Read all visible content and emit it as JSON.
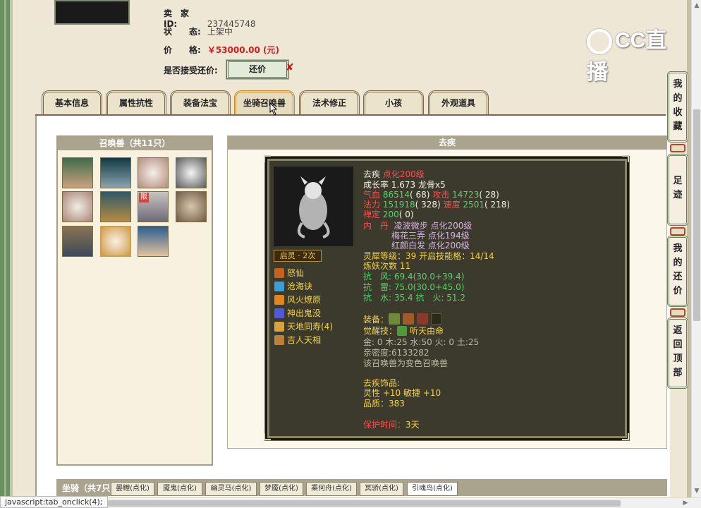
{
  "seller": {
    "id_label": "卖　家　ID:",
    "id_value": "237445748",
    "status_label": "状　　态:",
    "status_value": "上架中",
    "price_label": "价　　格:",
    "price_value": "￥53000.00 (元)",
    "counter_label": "是否接受还价:",
    "counter_button": "还价",
    "counter_no": "✘"
  },
  "logo": {
    "text": "CC直播"
  },
  "tabs": [
    "基本信息",
    "属性抗性",
    "装备法宝",
    "坐骑召唤兽",
    "法术修正",
    "小孩",
    "外观道具"
  ],
  "active_tab": "坐骑召唤兽",
  "pet_list": {
    "title": "召唤兽（共11只）",
    "count": 11,
    "limited_badge": "限"
  },
  "detail": {
    "title": "去疾",
    "name": "去疾",
    "name_note": "点化200级",
    "growth": "成长率 1.673 龙骨x5",
    "qixue_label": "气血",
    "qixue_value": "86514",
    "qixue_paren": "( 68)",
    "gongji_label": "攻击",
    "gongji_value": "14723",
    "gongji_paren": "( 28)",
    "fali_label": "法力",
    "fali_value": "151918",
    "fali_paren": "( 328)",
    "sudu_label": "速度",
    "sudu_value": "2501",
    "sudu_paren": "( 218)",
    "chanding_label": "禅定",
    "chanding_value": "200",
    "chanding_paren": "( 0)",
    "neidan_label": "内　丹",
    "neidan": [
      "凌波微步 点化200级",
      "梅花三弄 点化194级",
      "红颜白发 点化200级"
    ],
    "lingxi": "灵犀等级：39 开启技能格：14/14",
    "lianyao": "炼妖次数 11",
    "resist": [
      "抗　风: 69.4(30.0+39.4)",
      "抗　雷: 75.0(30.0+45.0)",
      "抗　水: 35.4 抗　火: 51.2"
    ],
    "equip_label": "装备：",
    "awaken_label": "觉醒技：",
    "awaken_skill": "听天由命",
    "elements": "金: 0 木:25 水:50 火: 0 土:25",
    "intimacy": "亲密度:6133282",
    "transform": "该召唤兽为变色召唤兽",
    "accessory_title": "去疾饰品:",
    "accessory_stats": "灵性 +10 敏捷 +10",
    "accessory_quality": "品质：383",
    "protect_label": "保护时间：",
    "protect_value": "3天",
    "qiling": "启灵 · 2次",
    "skills": [
      "怒仙",
      "沧海诀",
      "风火燎原",
      "神出鬼没",
      "天地同寿(4)",
      "吉人天相"
    ]
  },
  "side_nav": [
    "我的收藏",
    "足迹",
    "我的还价",
    "返回顶部"
  ],
  "mounts": {
    "title": "坐骑（共7只）",
    "tabs": [
      "晏鲤(点化)",
      "魇鬼(点化)",
      "幽灵马(点化)",
      "梦魇(点化)",
      "乘何舟(点化)",
      "冥骄(点化)",
      "引魂鸟(点化)"
    ]
  },
  "status_bar": "javascript:tab_onclick(4);",
  "colors": {
    "price": "#d51a1a",
    "card_bg": "#3b3a2c",
    "tab_active": "#c88b2c"
  }
}
